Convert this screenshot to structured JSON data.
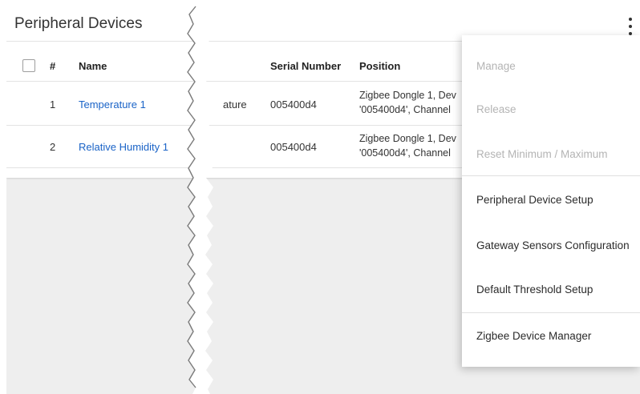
{
  "card": {
    "title": "Peripheral Devices"
  },
  "table": {
    "columns": [
      "#",
      "Name",
      "Serial Number",
      "Position"
    ],
    "rows": [
      {
        "index": "1",
        "name": "Temperature 1",
        "type_fragment": "ature",
        "serial": "005400d4",
        "position_line1": "Zigbee Dongle 1, Dev",
        "position_line2": "'005400d4', Channel"
      },
      {
        "index": "2",
        "name": "Relative Humidity 1",
        "type_fragment": "",
        "serial": "005400d4",
        "position_line1": "Zigbee Dongle 1, Dev",
        "position_line2": "'005400d4', Channel"
      }
    ]
  },
  "context_menu": {
    "items": [
      {
        "label": "Manage",
        "enabled": false
      },
      {
        "label": "Release",
        "enabled": false
      },
      {
        "label": "Reset Minimum / Maximum",
        "enabled": false
      },
      {
        "label": "Peripheral Device Setup",
        "enabled": true
      },
      {
        "label": "Gateway Sensors Configuration",
        "enabled": true
      },
      {
        "label": "Default Threshold Setup",
        "enabled": true
      },
      {
        "label": "Zigbee Device Manager",
        "enabled": true
      }
    ]
  },
  "icons": {
    "more": "more-vert-icon",
    "select_all": "checkbox-icon"
  },
  "colors": {
    "link": "#1a63c7",
    "disabled_text": "#b4b4b4",
    "background": "#eeeeee"
  }
}
